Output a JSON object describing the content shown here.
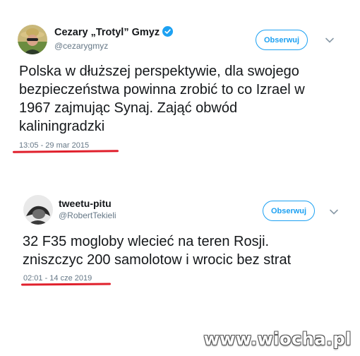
{
  "tweets": [
    {
      "display_name": "Cezary „Trotyl” Gmyz",
      "verified": true,
      "handle": "@cezarygmyz",
      "follow_label": "Obserwuj",
      "text": "Polska w dłuższej perspektywie, dla swojego\nbezpieczeństwa powinna zrobić to co Izrael w\n1967 zajmując Synaj. Zająć obwód\nkaliningradzki",
      "timestamp": "13:05 - 29 mar 2015"
    },
    {
      "display_name": "tweetu-pitu",
      "verified": false,
      "handle": "@RobertTekieli",
      "follow_label": "Obserwuj",
      "text": "32 F35 mogloby wlecieć na teren Rosji.\nzniszczyc 200 samolotow i wrocic bez strat",
      "timestamp": "02:01 - 14 cze 2019"
    }
  ],
  "watermark": "www.wiocha.pl",
  "colors": {
    "accent": "#1da1f2",
    "verified": "#1da1f2",
    "annotation": "#e0202c",
    "secondary_text": "#657786"
  }
}
